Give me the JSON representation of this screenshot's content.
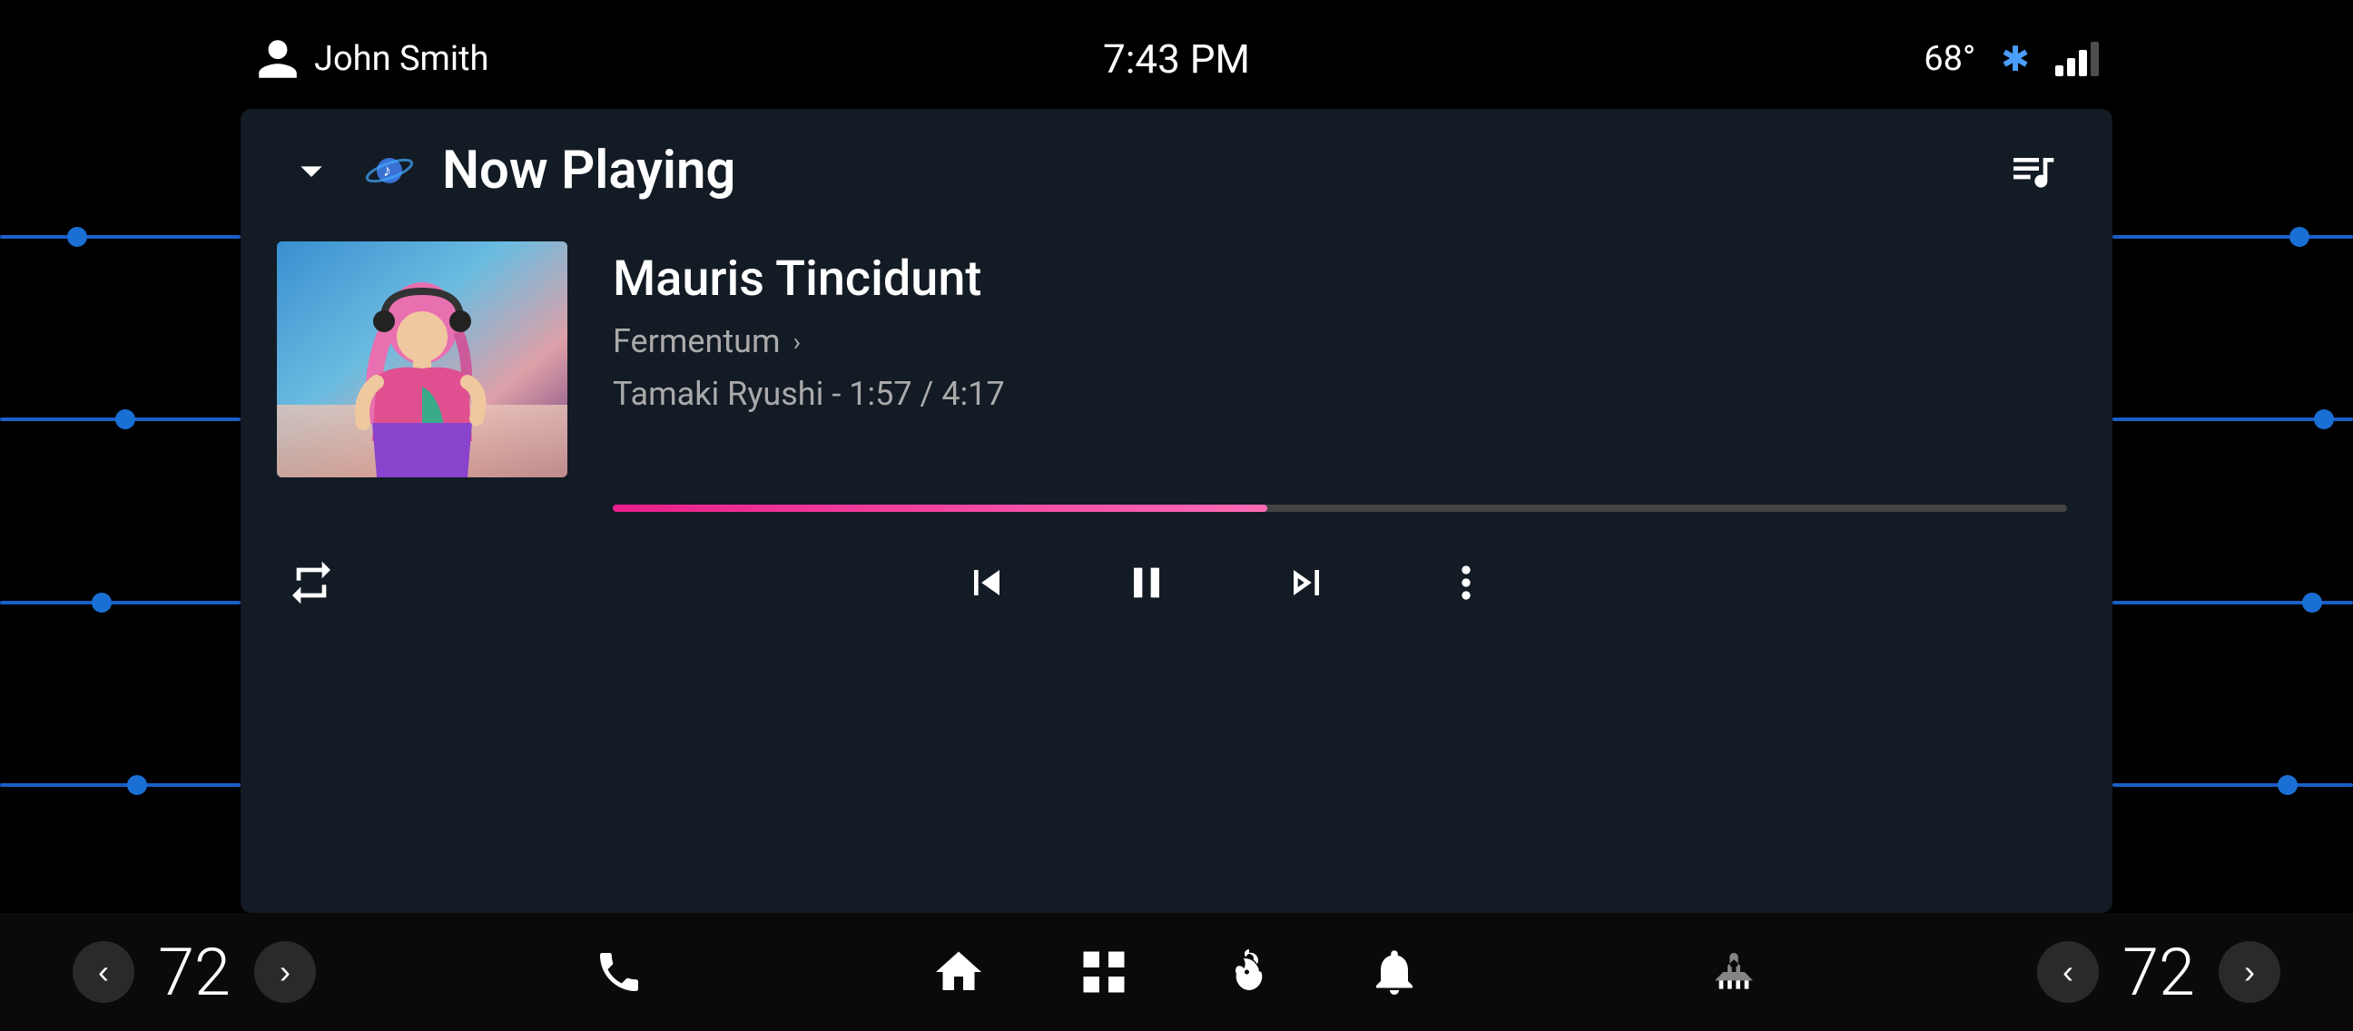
{
  "statusBar": {
    "userName": "John Smith",
    "time": "7:43 PM",
    "temperature": "68°",
    "bluetoothIcon": "bluetooth",
    "signalIcon": "signal"
  },
  "header": {
    "nowPlaying": "Now Playing",
    "chevronDown": "▾",
    "queueIcon": "☰"
  },
  "track": {
    "title": "Mauris Tincidunt",
    "album": "Fermentum",
    "artistTime": "Tamaki Ryushi - 1:57 / 4:17",
    "progressPercent": 45
  },
  "controls": {
    "repeatLabel": "repeat",
    "skipPrevLabel": "skip previous",
    "pauseLabel": "pause",
    "skipNextLabel": "skip next",
    "moreLabel": "more options"
  },
  "bottomNav": {
    "leftTemp": "72",
    "rightTemp": "72",
    "icons": [
      "phone",
      "home",
      "grid",
      "fan",
      "bell",
      "seat-heat"
    ]
  },
  "sliders": {
    "leftPositions": [
      0.3,
      0.5,
      0.4,
      0.55
    ],
    "rightPositions": [
      0.8,
      0.9,
      0.85,
      0.75
    ]
  }
}
